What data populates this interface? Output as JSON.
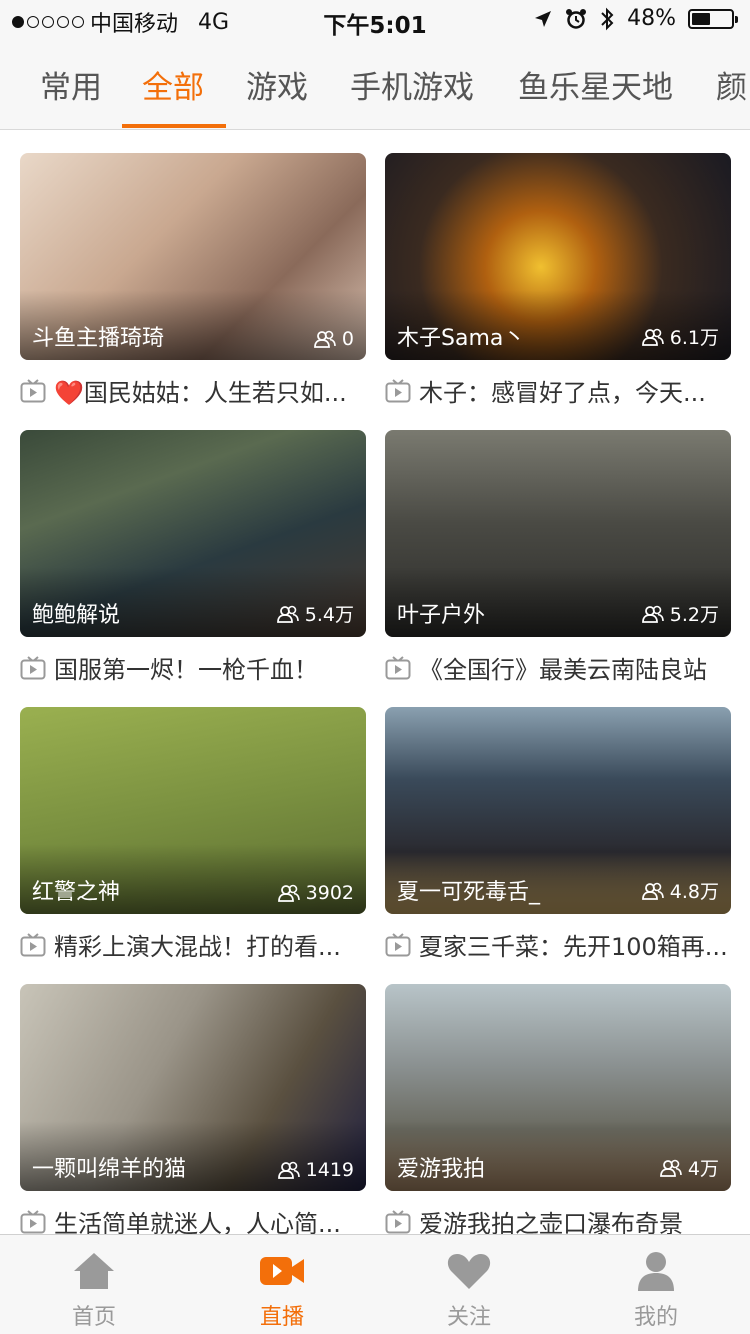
{
  "status_bar": {
    "carrier": "中国移动",
    "network": "4G",
    "time": "下午5:01",
    "battery_percent_text": "48%",
    "battery_level": 0.48
  },
  "category_tabs": [
    "常用",
    "全部",
    "游戏",
    "手机游戏",
    "鱼乐星天地",
    "颜"
  ],
  "active_tab": "全部",
  "cards": [
    {
      "anchor": "斗鱼主播琦琦",
      "viewers": "0",
      "title": "❤️国民姑姑：人生若只如..."
    },
    {
      "anchor": "木子Sama丶",
      "viewers": "6.1万",
      "title": "木子：感冒好了点，今天..."
    },
    {
      "anchor": "鲍鲍解说",
      "viewers": "5.4万",
      "title": "国服第一烬！一枪千血！"
    },
    {
      "anchor": "叶子户外",
      "viewers": "5.2万",
      "title": "《全国行》最美云南陆良站"
    },
    {
      "anchor": "红警之神",
      "viewers": "3902",
      "title": "精彩上演大混战！打的看..."
    },
    {
      "anchor": "夏一可死毒舌_",
      "viewers": "4.8万",
      "title": "夏家三千菜：先开100箱再..."
    },
    {
      "anchor": "一颗叫绵羊的猫",
      "viewers": "1419",
      "title": "生活简单就迷人，人心简..."
    },
    {
      "anchor": "爱游我拍",
      "viewers": "4万",
      "title": "爱游我拍之壶口瀑布奇景"
    }
  ],
  "bottom_nav": [
    {
      "label": "首页",
      "icon": "home-icon"
    },
    {
      "label": "直播",
      "icon": "live-camera-icon"
    },
    {
      "label": "关注",
      "icon": "heart-icon"
    },
    {
      "label": "我的",
      "icon": "user-icon"
    }
  ],
  "colors": {
    "accent": "#f36f0a",
    "inactive": "#9a9a9a"
  }
}
